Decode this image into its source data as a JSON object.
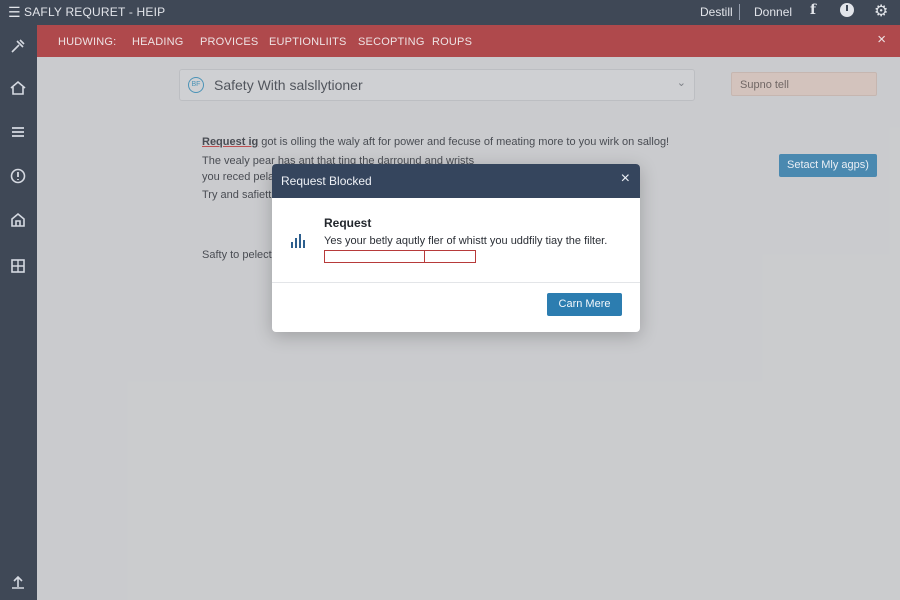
{
  "window": {
    "title": "SAFLY REQURET - HEIP",
    "right_links": [
      "Destill",
      "Donnel"
    ],
    "icons": [
      "menu-icon",
      "facebook-icon",
      "clock-icon",
      "settings-icon"
    ]
  },
  "sidebar": {
    "icons": [
      "tools-icon",
      "home-icon",
      "list-icon",
      "alert-icon",
      "store-icon",
      "layout-icon",
      "upload-icon"
    ]
  },
  "navbar": {
    "items": [
      "HUDWING:",
      "HEADING",
      "PROVICES",
      "EUPTIONLIITS",
      "SECOPTING",
      "ROUPS"
    ],
    "close_glyph": "×"
  },
  "content": {
    "dropdown": {
      "icon_text": "BF",
      "value": "Safety With salsllytioner"
    },
    "support_button": "Supno tell",
    "select_button": "Setact Mly agps)",
    "lines": {
      "line1_lead": "Request ig",
      "line1_rest": " got is olling the waly aft for power and fecuse of meating more to you wirk on sallog!",
      "line2": "The vealy pear has ant that ting the darround and wrists",
      "line3": "you reced pela",
      "line4": "Try and safiett",
      "line5": "Safty to pelect"
    }
  },
  "modal": {
    "title": "Request Blocked",
    "heading": "Request",
    "body": "Yes your betly aqutly fler of whistt you uddfily tiay the filter.",
    "button": "Carn Mere",
    "close_glyph": "×"
  },
  "colors": {
    "navbar_red": "#a82b2e",
    "dark_navy": "#1f2a3a",
    "modal_header": "#35455d",
    "accent_blue": "#2c7db0"
  }
}
